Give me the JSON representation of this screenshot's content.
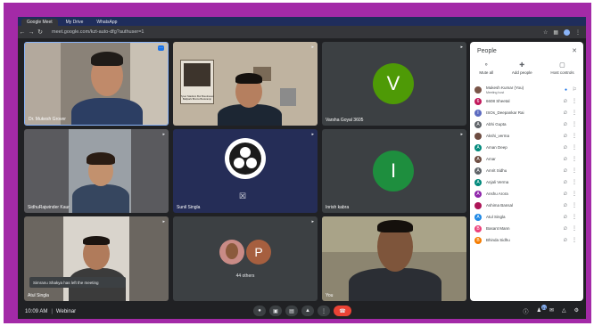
{
  "browser": {
    "tabs": [
      "Google Meet",
      "My Drive",
      "WhatsApp"
    ],
    "url": "meet.google.com/kzt-auto-dfg?authuser=1"
  },
  "tiles": [
    {
      "name": "Dr. Mukesh Grover",
      "kind": "video"
    },
    {
      "name": "",
      "kind": "video",
      "sign": "Tyser Stadium Bur Boudreaux Ballpark Bruins Bootcamp"
    },
    {
      "name": "Varsha Goyal 3605",
      "kind": "avatar",
      "letter": "V",
      "color": "#4e9a06"
    },
    {
      "name": "SidhuRajwinder Kaur",
      "kind": "video"
    },
    {
      "name": "Sunil Singla",
      "kind": "obs"
    },
    {
      "name": "Inrish kabra",
      "kind": "avatar",
      "letter": "I",
      "color": "#1e8e3e"
    },
    {
      "name": "Atul Singla",
      "kind": "video",
      "toast": "Simranu Shakya has left the meeting"
    },
    {
      "name": "",
      "kind": "others",
      "letter": "P",
      "label": "44 others"
    },
    {
      "name": "You",
      "kind": "video"
    }
  ],
  "people": {
    "title": "People",
    "actions": [
      "Mute all",
      "Add people",
      "Host controls"
    ],
    "participants": [
      {
        "name": "Mukesh Kumar (You)",
        "sub": "Meeting host",
        "letter": "",
        "color": "#795548"
      },
      {
        "name": "6608 Sheetal",
        "letter": "6",
        "color": "#c2185b"
      },
      {
        "name": "ISOs_Deepankar Rai",
        "letter": "I",
        "color": "#5c6bc0"
      },
      {
        "name": "Abhi Gupta",
        "letter": "A",
        "color": "#5f6368"
      },
      {
        "name": "Akshi_verma",
        "letter": "",
        "color": "#6d4c41"
      },
      {
        "name": "Aman Deep",
        "letter": "A",
        "color": "#00897b"
      },
      {
        "name": "Amar",
        "letter": "A",
        "color": "#6d4c41"
      },
      {
        "name": "Amrit Sidhu",
        "letter": "A",
        "color": "#5f6368"
      },
      {
        "name": "Anjali Verma",
        "letter": "A",
        "color": "#00897b"
      },
      {
        "name": "Anshu Arora",
        "letter": "A",
        "color": "#8e24aa"
      },
      {
        "name": "Ashima Bansal",
        "letter": "",
        "color": "#ad1457"
      },
      {
        "name": "Atul Singla",
        "letter": "A",
        "color": "#1e88e5"
      },
      {
        "name": "Basant Mann",
        "letter": "B",
        "color": "#ec407a"
      },
      {
        "name": "Bhinda Sidhu",
        "letter": "B",
        "color": "#f57c00"
      }
    ]
  },
  "bottom": {
    "time": "10:09 AM",
    "separator": "|",
    "meeting": "Webinar",
    "badge": "51"
  }
}
